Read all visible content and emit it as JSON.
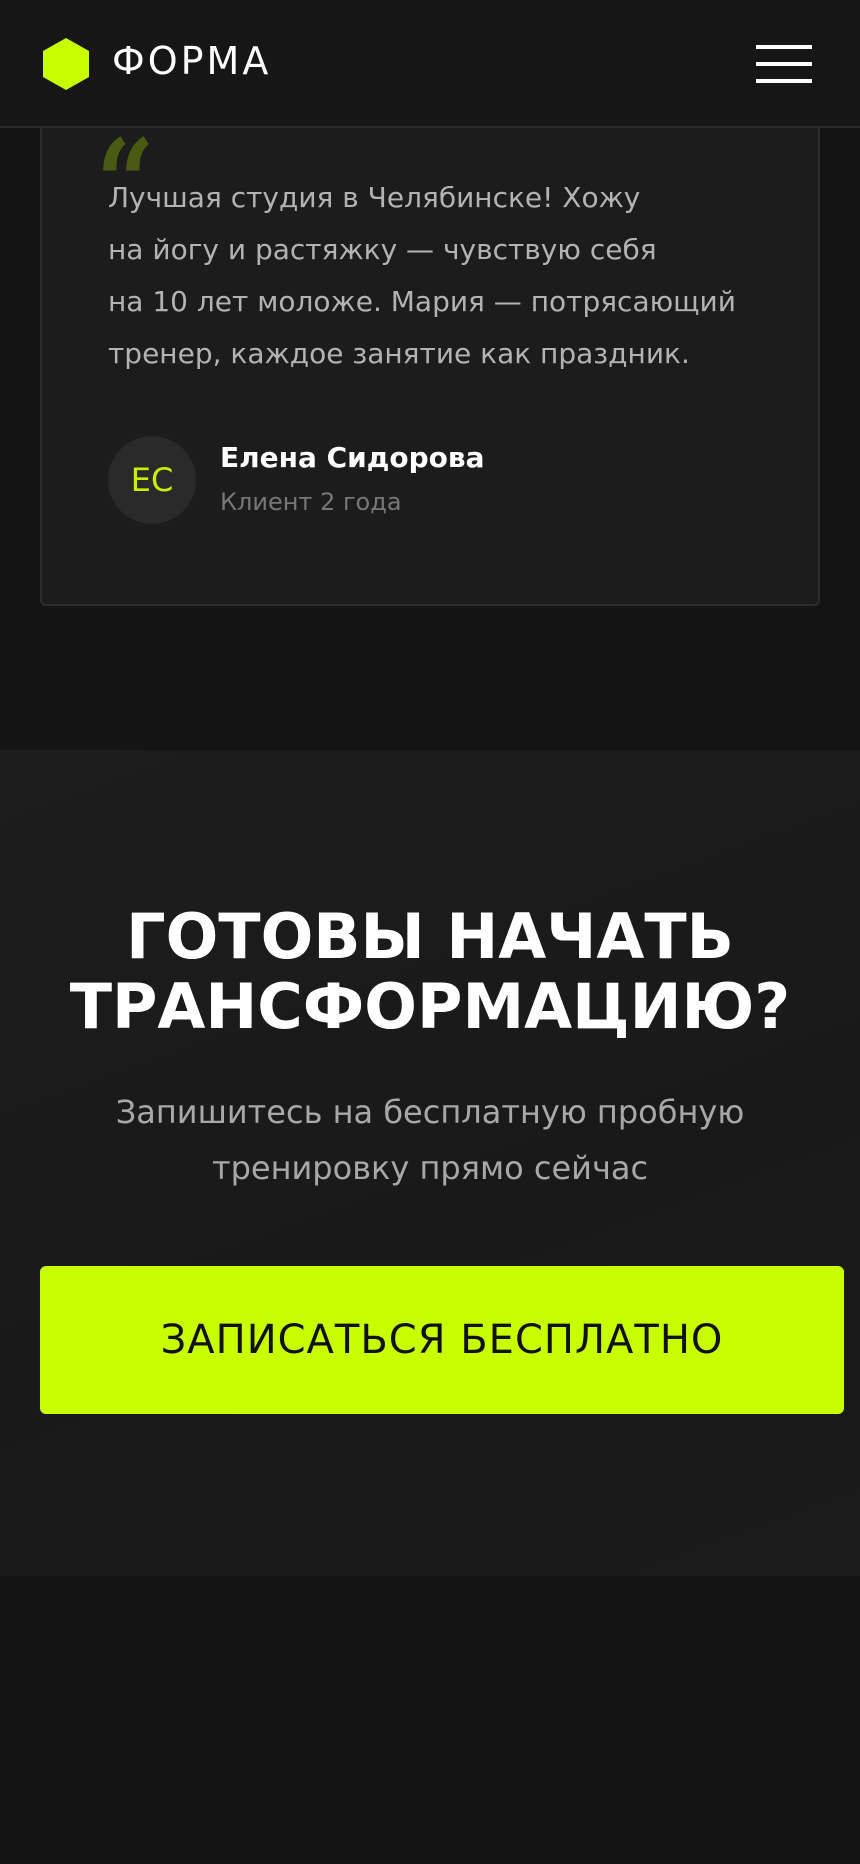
{
  "header": {
    "logo_text": "ФОРМА",
    "logo_icon": "hexagon-icon",
    "menu_icon": "hamburger-menu-icon",
    "accent_color": "#c8ff00"
  },
  "testimonial": {
    "quote_icon": "quote-icon",
    "quote_mark": "“",
    "text_lines": [
      "Лучшая студия в Челябинске! Хожу",
      "на йогу и растяжку — чувствую себя",
      "на 10 лет моложе. Мария — потрясающий",
      "тренер, каждое занятие как праздник."
    ],
    "author": {
      "initials": "ЕС",
      "name": "Елена Сидорова",
      "meta": "Клиент 2 года"
    }
  },
  "cta": {
    "title_lines": [
      "ГОТОВЫ НАЧАТЬ",
      "ТРАНСФОРМАЦИЮ?"
    ],
    "subtitle_lines": [
      "Запишитесь на бесплатную пробную",
      "тренировку прямо сейчас"
    ],
    "button_label": "ЗАПИСАТЬСЯ БЕСПЛАТНО"
  }
}
